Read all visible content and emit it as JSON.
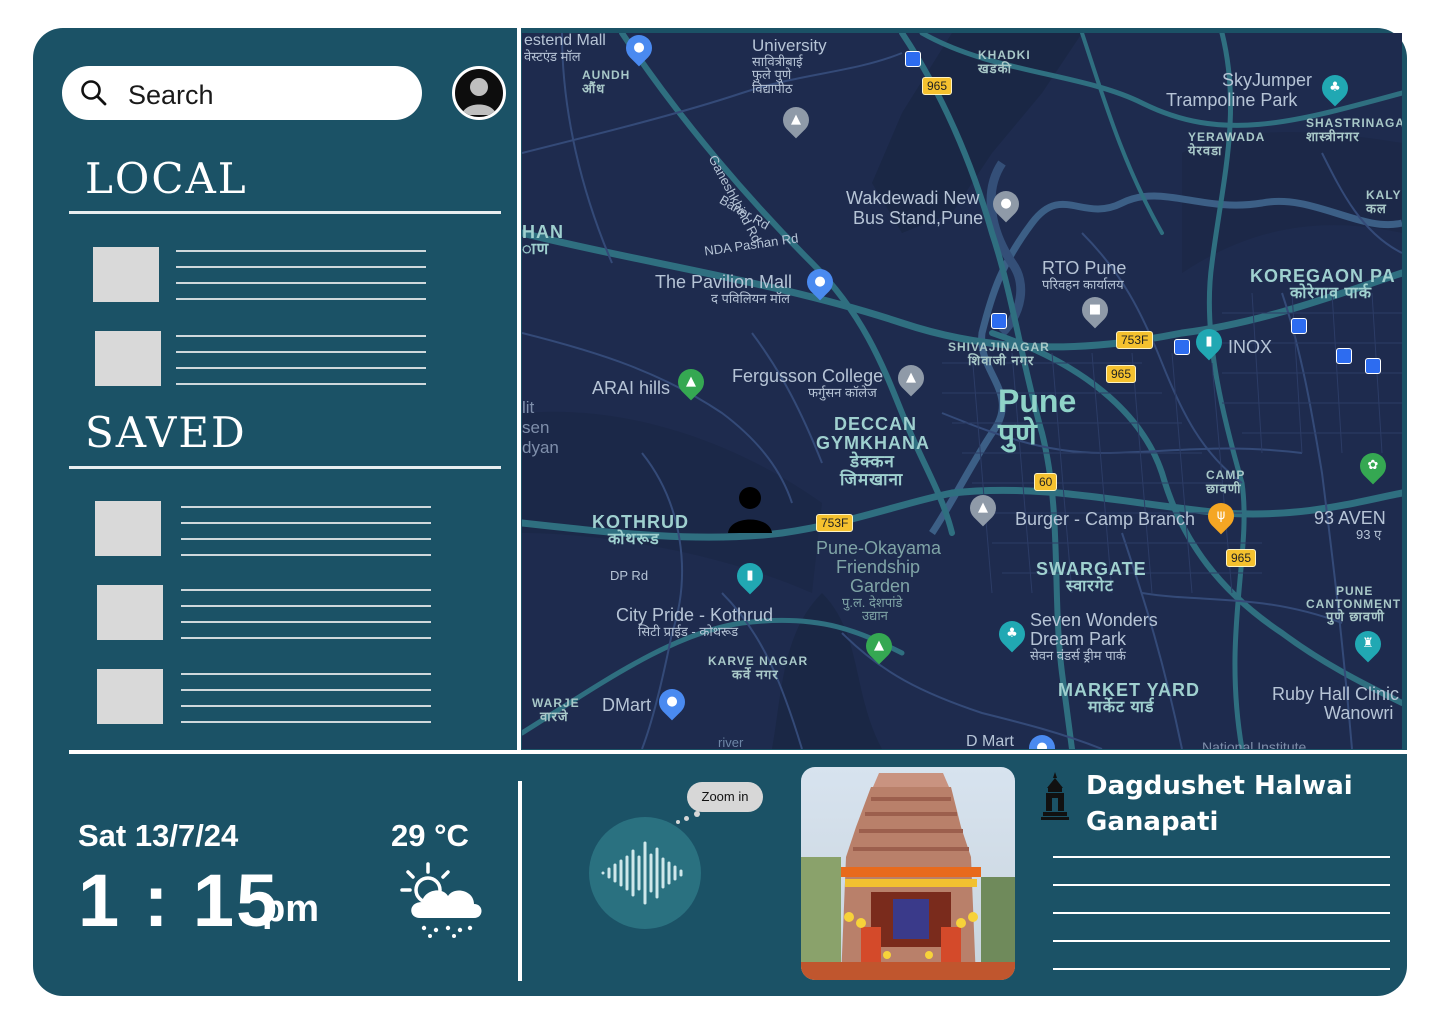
{
  "search": {
    "label": "Search"
  },
  "sidebar": {
    "local_title": "LOCAL",
    "saved_title": "SAVED"
  },
  "map": {
    "labels": {
      "westend": "estend Mall",
      "westend_sub": "वेस्टएंड मॉल",
      "aundh": "AUNDH",
      "aundh_sub": "औंध",
      "university": "University",
      "university_sub1": "सावित्रीबाई",
      "university_sub2": "फुले पुणे",
      "university_sub3": "विद्यापीठ",
      "khadki": "KHADKI",
      "khadki_sub": "खडकी",
      "skyjumper1": "SkyJumper",
      "skyjumper2": "Trampoline Park",
      "yerawada": "YERAWADA",
      "yerawada_sub": "येरवडा",
      "shastrinagar": "SHASTRINAGA",
      "shastrinagar_sub": "शास्त्रीनगर",
      "kalyani": "KALY",
      "kalyani_sub": "कल",
      "ganeshkhind": "Ganeshkhind Rd",
      "baner": "Baner Rd",
      "wakdewadi1": "Wakdewadi New",
      "wakdewadi2": "Bus Stand,Pune",
      "han": "HAN",
      "han_sub": "ाण",
      "nda": "NDA Pashan Rd",
      "pavilion": "The Pavilion Mall",
      "pavilion_sub": "द पविलियन मॉल",
      "rto": "RTO Pune",
      "rto_sub": "परिवहन कार्यालय",
      "koregaon": "KOREGAON PA",
      "koregaon_sub": "कोरेगाव पार्क",
      "shivajinagar": "SHIVAJINAGAR",
      "shivajinagar_sub": "शिवाजी नगर",
      "inox": "INOX",
      "arai": "ARAI hills",
      "fergusson": "Fergusson College",
      "fergusson_sub": "फर्गुसन कॉलेज",
      "pune": "Pune",
      "pune_sub": "पुणे",
      "deccan1": "DECCAN",
      "deccan2": "GYMKHANA",
      "deccan_sub1": "डेक्कन",
      "deccan_sub2": "जिमखाना",
      "lit": "lit",
      "sen": "sen",
      "dyan": "dyan",
      "camp": "CAMP",
      "camp_sub": "छावणी",
      "avenue": "93 AVEN",
      "avenue_sub": "93 ए",
      "kothrud": "KOTHRUD",
      "kothrud_sub": "कोथरूड",
      "burger": "Burger - Camp Branch",
      "okayama1": "Pune-Okayama",
      "okayama2": "Friendship",
      "okayama3": "Garden",
      "okayama_sub1": "पु.ल. देशपांडे",
      "okayama_sub2": "उद्यान",
      "swargate": "SWARGATE",
      "swargate_sub": "स्वारगेट",
      "dprd": "DP Rd",
      "citypride": "City Pride - Kothrud",
      "citypride_sub": "सिटी प्राईड - कोथरूड",
      "cantonment": "PUNE",
      "cantonment2": "CANTONMENT",
      "cantonment_sub": "पुणे छावणी",
      "sevenwonders1": "Seven Wonders",
      "sevenwonders2": "Dream Park",
      "sevenwonders_sub": "सेवन वंडर्स ड्रीम पार्क",
      "karvenagar": "KARVE NAGAR",
      "karvenagar_sub": "कर्वे नगर",
      "marketyard": "MARKET YARD",
      "marketyard_sub": "मार्केट यार्ड",
      "rubyhall1": "Ruby Hall Clinic",
      "rubyhall2": "Wanowri",
      "warje": "WARJE",
      "warje_sub": "वारजे",
      "dmart": "DMart",
      "dmart2": "D Mart",
      "river": "river",
      "national": "National Institute"
    },
    "badges": {
      "b965a": "965",
      "b965b": "965",
      "b965c": "965",
      "b753fa": "753F",
      "b753fb": "753F",
      "b60": "60"
    }
  },
  "status": {
    "date": "Sat 13/7/24",
    "time": "1 : 15",
    "ampm": "pm",
    "temperature": "29 °C",
    "weather_icon": "partly-cloudy-rain-icon"
  },
  "voice": {
    "bubble": "Zoom in",
    "icon": "sound-wave-icon"
  },
  "place": {
    "title": "Dagdushet Halwai Ganapati",
    "icon": "temple-icon"
  },
  "colors": {
    "panel": "#1b5266",
    "map_bg": "#1e2b4e",
    "accent": "#2a7180"
  }
}
